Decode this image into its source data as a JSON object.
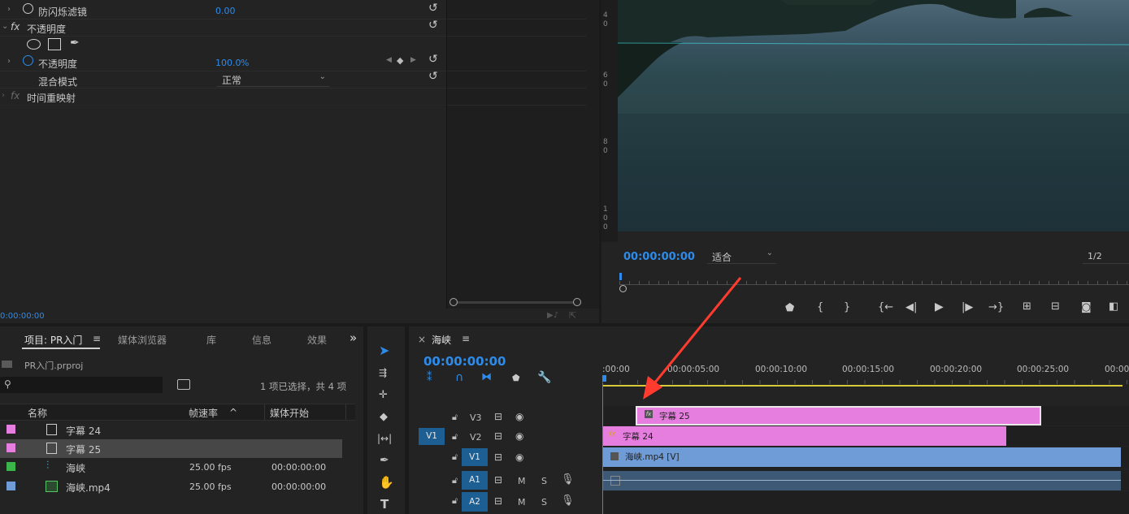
{
  "effect_controls": {
    "rows": [
      {
        "label": "防闪烁滤镜",
        "value": "0.00"
      },
      {
        "label": "不透明度"
      },
      {
        "label": "不透明度",
        "value": "100.0",
        "unit": "%"
      },
      {
        "label": "混合模式",
        "value": "正常"
      },
      {
        "label": "时间重映射"
      }
    ],
    "fx_glyph": "fx",
    "timecode": "0:00:00:00"
  },
  "program_monitor": {
    "timecode": "00:00:00:00",
    "fit_label": "适合",
    "resolution": "1/2",
    "ruler_digits": [
      "4",
      "0",
      "6",
      "0",
      "8",
      "0",
      "1",
      "0",
      "0"
    ]
  },
  "project_panel": {
    "tabs": [
      "项目: PR入门",
      "媒体浏览器",
      "库",
      "信息",
      "效果"
    ],
    "menu_glyph": "≡",
    "more_glyph": "»",
    "project_file": "PR入门.prproj",
    "selection_info": "1 项已选择，共 4 项",
    "columns": [
      "名称",
      "帧速率",
      "媒体开始"
    ],
    "sort_glyph": "^",
    "items": [
      {
        "name": "字幕 24",
        "fps": "",
        "start": "",
        "color": "#e67ee0"
      },
      {
        "name": "字幕 25",
        "fps": "",
        "start": "",
        "color": "#e67ee0"
      },
      {
        "name": "海峡",
        "fps": "25.00 fps",
        "start": "00:00:00:00",
        "color": "#3bb54a"
      },
      {
        "name": "海峡.mp4",
        "fps": "25.00 fps",
        "start": "00:00:00:00",
        "color": "#6f9bd6"
      }
    ]
  },
  "timeline": {
    "close_glyph": "×",
    "sequence_name": "海峡",
    "menu_glyph": "≡",
    "timecode": "00:00:00:00",
    "ruler_labels": [
      ":00:00",
      "00:00:05:00",
      "00:00:10:00",
      "00:00:15:00",
      "00:00:20:00",
      "00:00:25:00",
      "00:00:"
    ],
    "tracks": [
      {
        "name": "V3",
        "src": ""
      },
      {
        "name": "V2",
        "src": "V1"
      },
      {
        "name": "V1",
        "src": ""
      },
      {
        "name": "A1",
        "src": "",
        "m": "M",
        "s": "S"
      },
      {
        "name": "A2",
        "src": "",
        "m": "M",
        "s": "S"
      }
    ],
    "clips": {
      "v3": "字幕 25",
      "v2": "字幕 24",
      "v1": "海峡.mp4 [V]",
      "v2_fx": "fx",
      "v3_fx": "fx"
    }
  },
  "tools": {
    "type_glyph": "T"
  },
  "colors": {
    "accent": "#2d8ceb",
    "label_pink": "#e67ee0",
    "video_clip": "#6f9bd6",
    "annotation_arrow": "#ff3b2f"
  }
}
